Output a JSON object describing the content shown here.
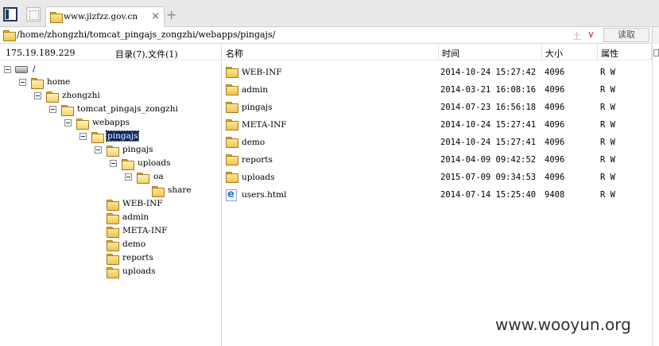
{
  "tab": {
    "title": "www.jlzfzz.gov.cn",
    "close": "×",
    "new_tab": "+"
  },
  "address": {
    "path": "/home/zhongzhi/tomcat_pingajs_zongzhi/webapps/pingajs/",
    "sep": "土",
    "dropdown": "∨",
    "read_button": "读取"
  },
  "left": {
    "ip": "175.19.189.229",
    "counts": "目录(7),文件(1)",
    "tree": [
      {
        "label": "/"
      },
      {
        "label": "home"
      },
      {
        "label": "zhongzhi"
      },
      {
        "label": "tomcat_pingajs_zongzhi"
      },
      {
        "label": "webapps"
      },
      {
        "label": "pingajs"
      },
      {
        "label": "pingajs"
      },
      {
        "label": "uploads"
      },
      {
        "label": "oa"
      },
      {
        "label": "share"
      },
      {
        "label": "WEB-INF"
      },
      {
        "label": "admin"
      },
      {
        "label": "META-INF"
      },
      {
        "label": "demo"
      },
      {
        "label": "reports"
      },
      {
        "label": "uploads"
      }
    ]
  },
  "list": {
    "columns": {
      "name": "名称",
      "time": "时间",
      "size": "大小",
      "attr": "属性"
    },
    "rows": [
      {
        "name": "WEB-INF",
        "time": "2014-10-24 15:27:42",
        "size": "4096",
        "attr": "R W",
        "icon": "folder-icon"
      },
      {
        "name": "admin",
        "time": "2014-03-21 16:08:16",
        "size": "4096",
        "attr": "R W",
        "icon": "folder-icon"
      },
      {
        "name": "pingajs",
        "time": "2014-07-23 16:56:18",
        "size": "4096",
        "attr": "R W",
        "icon": "folder-icon"
      },
      {
        "name": "META-INF",
        "time": "2014-10-24 15:27:41",
        "size": "4096",
        "attr": "R W",
        "icon": "folder-icon"
      },
      {
        "name": "demo",
        "time": "2014-10-24 15:27:41",
        "size": "4096",
        "attr": "R W",
        "icon": "folder-icon"
      },
      {
        "name": "reports",
        "time": "2014-04-09 09:42:52",
        "size": "4096",
        "attr": "R W",
        "icon": "folder-icon"
      },
      {
        "name": "uploads",
        "time": "2015-07-09 09:34:53",
        "size": "4096",
        "attr": "R W",
        "icon": "folder-icon"
      },
      {
        "name": "users.html",
        "time": "2014-07-14 15:25:40",
        "size": "9408",
        "attr": "R W",
        "icon": "ie-html-icon"
      }
    ]
  },
  "watermark": "www.wooyun.org"
}
